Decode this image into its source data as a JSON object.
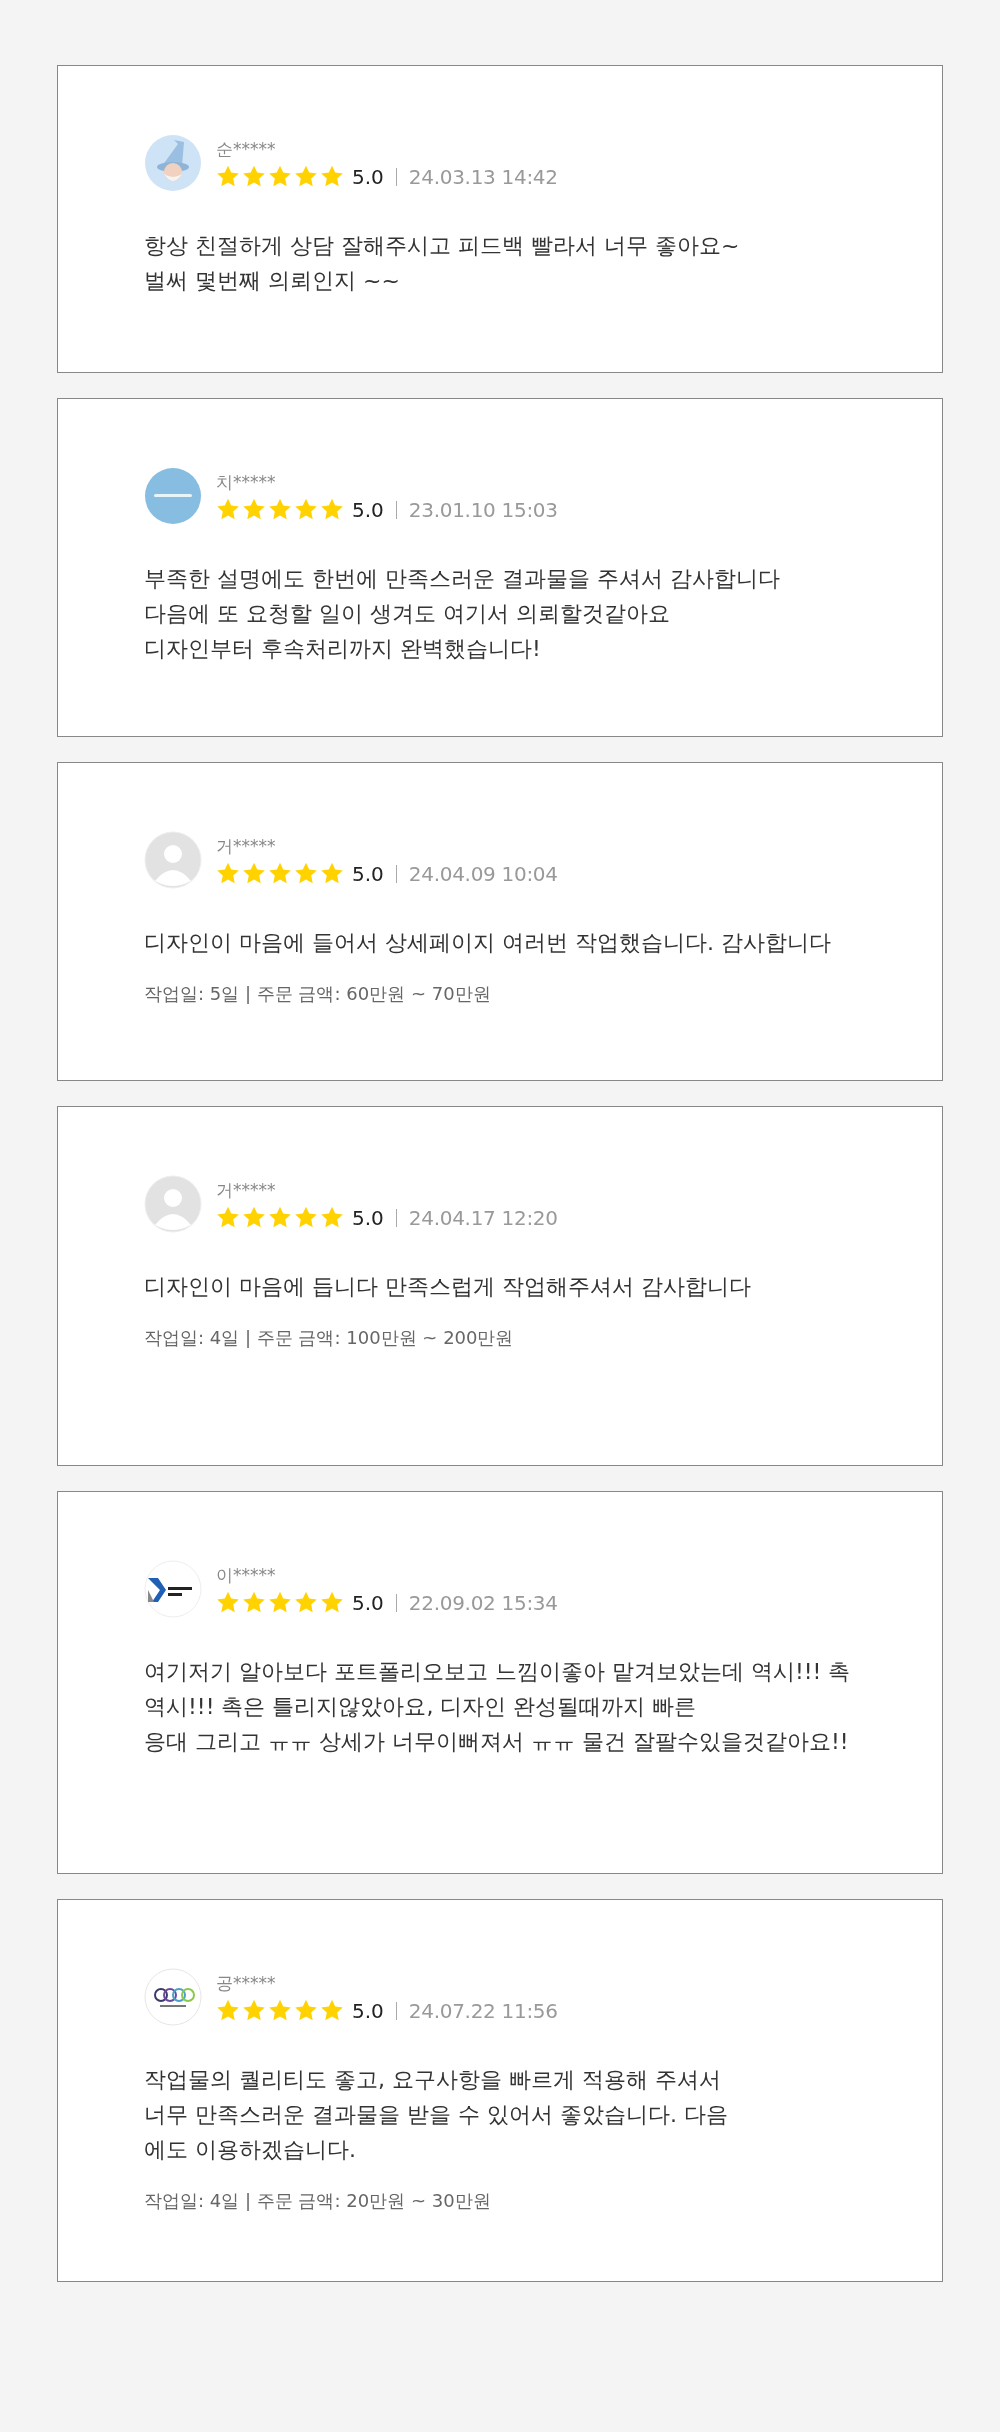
{
  "reviews": [
    {
      "avatar": {
        "kind": "wizard"
      },
      "name": "순*****",
      "stars": 5,
      "score": "5.0",
      "date": "24.03.13 14:42",
      "lines": [
        "항상 친절하게 상담 잘해주시고 피드백 빨라서 너무 좋아요~",
        "벌써 몇번째 의뢰인지 ~~"
      ]
    },
    {
      "avatar": {
        "kind": "circle-logo"
      },
      "name": "치*****",
      "stars": 5,
      "score": "5.0",
      "date": "23.01.10 15:03",
      "lines": [
        "부족한 설명에도 한번에 만족스러운 결과물을 주셔서 감사합니다",
        "다음에 또 요청할 일이 생겨도 여기서 의뢰할것같아요",
        "디자인부터 후속처리까지 완벽했습니다!"
      ]
    },
    {
      "avatar": {
        "kind": "default"
      },
      "name": "거*****",
      "stars": 5,
      "score": "5.0",
      "date": "24.04.09 10:04",
      "lines": [
        "디자인이 마음에 들어서 상세페이지 여러번 작업했습니다. 감사합니다"
      ],
      "order_info": "작업일: 5일 | 주문 금액: 60만원 ~ 70만원"
    },
    {
      "avatar": {
        "kind": "default"
      },
      "name": "거*****",
      "stars": 5,
      "score": "5.0",
      "date": "24.04.17 12:20",
      "lines": [
        "디자인이 마음에 듭니다 만족스럽게 작업해주셔서 감사합니다"
      ],
      "order_info": "작업일: 4일 | 주문 금액: 100만원 ~ 200만원"
    },
    {
      "avatar": {
        "kind": "k-logo"
      },
      "name": "이*****",
      "stars": 5,
      "score": "5.0",
      "date": "22.09.02 15:34",
      "lines": [
        "여기저기 알아보다 포트폴리오보고 느낌이좋아 맡겨보았는데 역시!!! 촉",
        "역시!!! 촉은 틀리지않았아요, 디자인 완성될때까지 빠른",
        "응대 그리고 ㅠㅠ 상세가 너무이뻐져서 ㅠㅠ 물건 잘팔수있을것같아요!!"
      ]
    },
    {
      "avatar": {
        "kind": "rings-logo"
      },
      "name": "공*****",
      "stars": 5,
      "score": "5.0",
      "date": "24.07.22 11:56",
      "lines": [
        "작업물의 퀄리티도 좋고, 요구사항을 빠르게 적용해 주셔서",
        "너무 만족스러운 결과물을 받을 수 있어서 좋았습니다. 다음",
        "에도 이용하겠습니다."
      ],
      "order_info": "작업일: 4일 | 주문 금액: 20만원 ~ 30만원"
    }
  ]
}
